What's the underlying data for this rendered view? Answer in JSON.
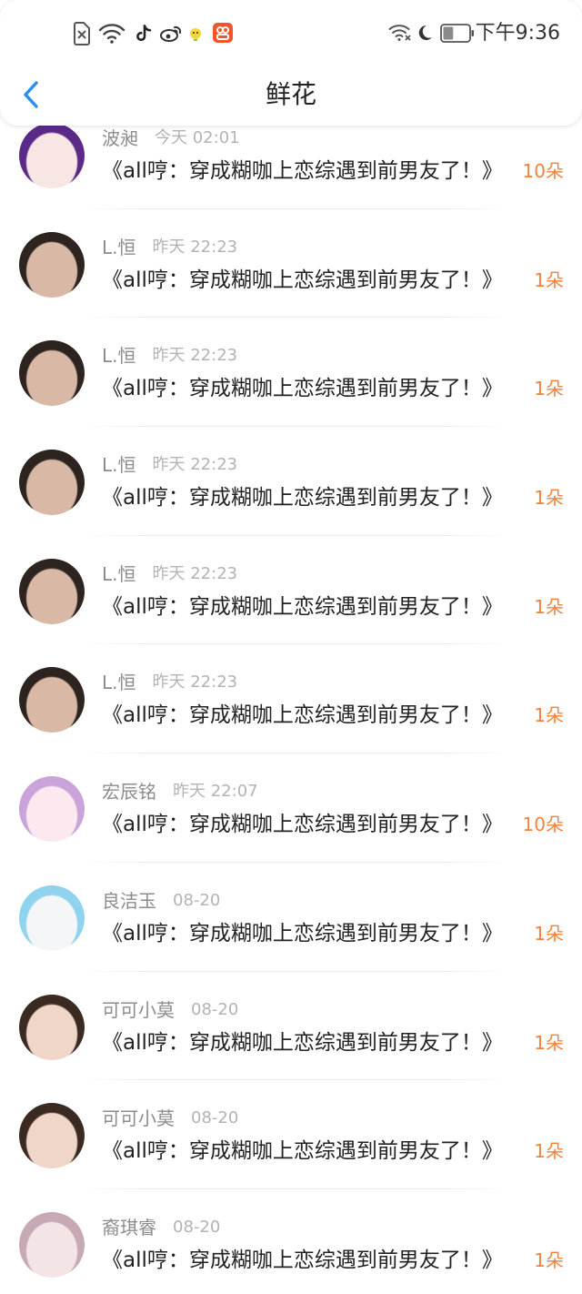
{
  "status_bar": {
    "time": "下午9:36",
    "left_icons": [
      "sim-off-icon",
      "wifi-hotspot-icon",
      "tiktok-icon",
      "weibo-icon",
      "chick-app-icon",
      "orange-app-icon"
    ],
    "right_icons": [
      "wifi-icon",
      "moon-icon",
      "battery-icon"
    ],
    "battery_level": 0.4
  },
  "header": {
    "title": "鲜花",
    "back_icon": "chevron-left-icon",
    "accent": "#2b8ff0"
  },
  "colors": {
    "count": "#f5823a",
    "name": "#8c8c8c",
    "time": "#b3b3b3",
    "title": "#222222"
  },
  "list": {
    "items": [
      {
        "name": "波昶",
        "time": "今天 02:01",
        "book": "《all哼：穿成糊咖上恋综遇到前男友了！》",
        "count": "10朵",
        "avatar_colors": [
          "#f7e6e4",
          "#5b2a88"
        ]
      },
      {
        "name": "L.恒",
        "time": "昨天 22:23",
        "book": "《all哼：穿成糊咖上恋综遇到前男友了！》",
        "count": "1朵",
        "avatar_colors": [
          "#d9b8a5",
          "#2d2420"
        ]
      },
      {
        "name": "L.恒",
        "time": "昨天 22:23",
        "book": "《all哼：穿成糊咖上恋综遇到前男友了！》",
        "count": "1朵",
        "avatar_colors": [
          "#d9b8a5",
          "#2d2420"
        ]
      },
      {
        "name": "L.恒",
        "time": "昨天 22:23",
        "book": "《all哼：穿成糊咖上恋综遇到前男友了！》",
        "count": "1朵",
        "avatar_colors": [
          "#d9b8a5",
          "#2d2420"
        ]
      },
      {
        "name": "L.恒",
        "time": "昨天 22:23",
        "book": "《all哼：穿成糊咖上恋综遇到前男友了！》",
        "count": "1朵",
        "avatar_colors": [
          "#d9b8a5",
          "#2d2420"
        ]
      },
      {
        "name": "L.恒",
        "time": "昨天 22:23",
        "book": "《all哼：穿成糊咖上恋综遇到前男友了！》",
        "count": "1朵",
        "avatar_colors": [
          "#d9b8a5",
          "#2d2420"
        ]
      },
      {
        "name": "宏辰铭",
        "time": "昨天 22:07",
        "book": "《all哼：穿成糊咖上恋综遇到前男友了！》",
        "count": "10朵",
        "avatar_colors": [
          "#fbe9ef",
          "#c9a3d9"
        ]
      },
      {
        "name": "良洁玉",
        "time": "08-20",
        "book": "《all哼：穿成糊咖上恋综遇到前男友了！》",
        "count": "1朵",
        "avatar_colors": [
          "#f4f6f8",
          "#8fd3ee"
        ]
      },
      {
        "name": "可可小莫",
        "time": "08-20",
        "book": "《all哼：穿成糊咖上恋综遇到前男友了！》",
        "count": "1朵",
        "avatar_colors": [
          "#f0d6c8",
          "#3a2a22"
        ]
      },
      {
        "name": "可可小莫",
        "time": "08-20",
        "book": "《all哼：穿成糊咖上恋综遇到前男友了！》",
        "count": "1朵",
        "avatar_colors": [
          "#f0d6c8",
          "#3a2a22"
        ]
      },
      {
        "name": "裔琪睿",
        "time": "08-20",
        "book": "《all哼：穿成糊咖上恋综遇到前男友了！》",
        "count": "1朵",
        "avatar_colors": [
          "#f3e4e6",
          "#c7a9b5"
        ]
      }
    ]
  }
}
